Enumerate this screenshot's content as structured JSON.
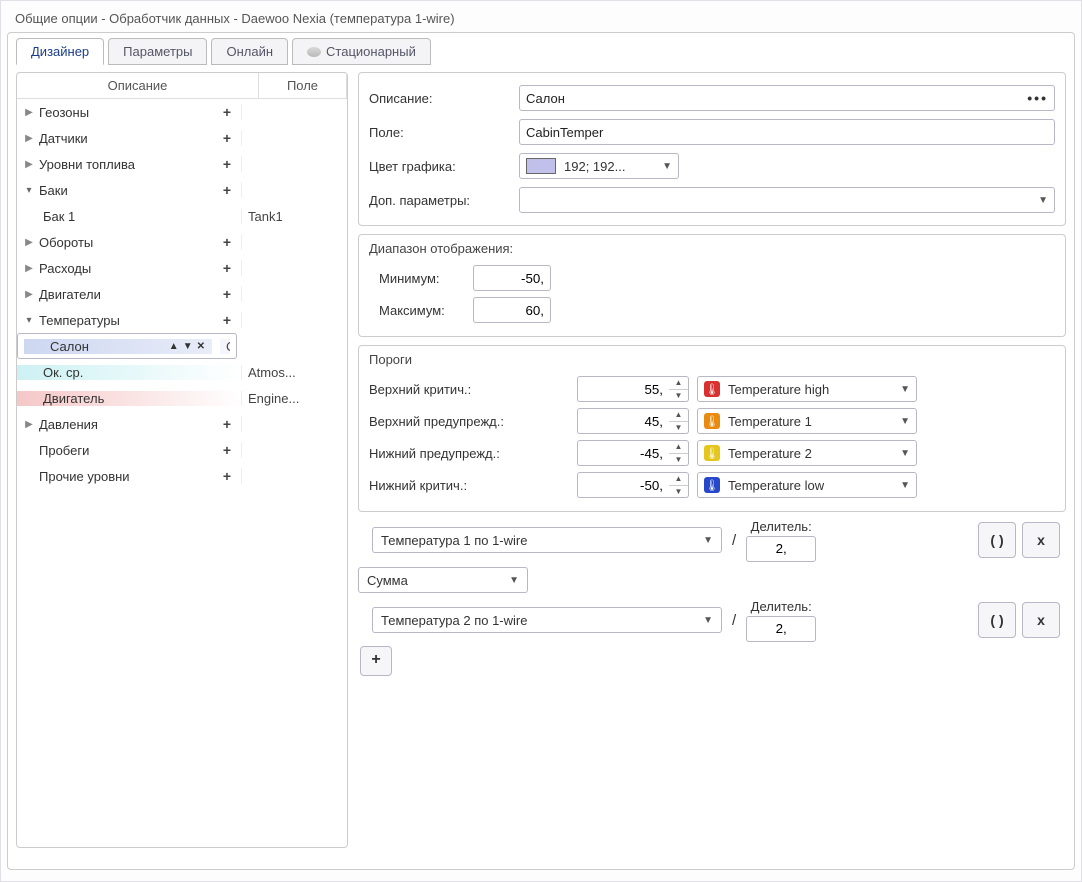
{
  "window_title": "Общие опции - Обработчик данных - Daewoo Nexia (температура 1-wire)",
  "tabs": {
    "designer": "Дизайнер",
    "params": "Параметры",
    "online": "Онлайн",
    "stationary": "Стационарный"
  },
  "grid": {
    "col_desc": "Описание",
    "col_field": "Поле"
  },
  "tree": {
    "geozones": "Геозоны",
    "sensors": "Датчики",
    "fuel_levels": "Уровни топлива",
    "tanks": "Баки",
    "tank1": {
      "desc": "Бак 1",
      "field": "Tank1"
    },
    "rpm": "Обороты",
    "cons": "Расходы",
    "engines": "Двигатели",
    "temps": "Температуры",
    "salon": {
      "desc": "Салон",
      "field": "CabinT..."
    },
    "ambient": {
      "desc": "Ок. ср.",
      "field": "Atmos..."
    },
    "engine": {
      "desc": "Двигатель",
      "field": "Engine..."
    },
    "press": "Давления",
    "mileage": "Пробеги",
    "other": "Прочие уровни"
  },
  "form": {
    "desc_label": "Описание:",
    "desc_value": "Салон",
    "field_label": "Поле:",
    "field_value": "CabinTemper",
    "color_label": "Цвет графика:",
    "color_value": "192; 192...",
    "addparams_label": "Доп. параметры:"
  },
  "range": {
    "legend": "Диапазон отображения:",
    "min_label": "Минимум:",
    "min_value": "-50,",
    "max_label": "Максимум:",
    "max_value": "60,"
  },
  "thresh": {
    "legend": "Пороги",
    "upper_crit_label": "Верхний критич.:",
    "upper_crit_value": "55,",
    "upper_crit_sel": "Temperature high",
    "upper_warn_label": "Верхний предупрежд.:",
    "upper_warn_value": "45,",
    "upper_warn_sel": "Temperature 1",
    "lower_warn_label": "Нижний предупрежд.:",
    "lower_warn_value": "-45,",
    "lower_warn_sel": "Temperature 2",
    "lower_crit_label": "Нижний критич.:",
    "lower_crit_value": "-50,",
    "lower_crit_sel": "Temperature low"
  },
  "formula": {
    "src1": "Температура 1 по 1-wire",
    "agg": "Сумма",
    "src2": "Температура 2 по 1-wire",
    "div_label": "Делитель:",
    "div1": "2,",
    "div2": "2,",
    "paren": "( )",
    "x": "x",
    "plus": "+"
  }
}
